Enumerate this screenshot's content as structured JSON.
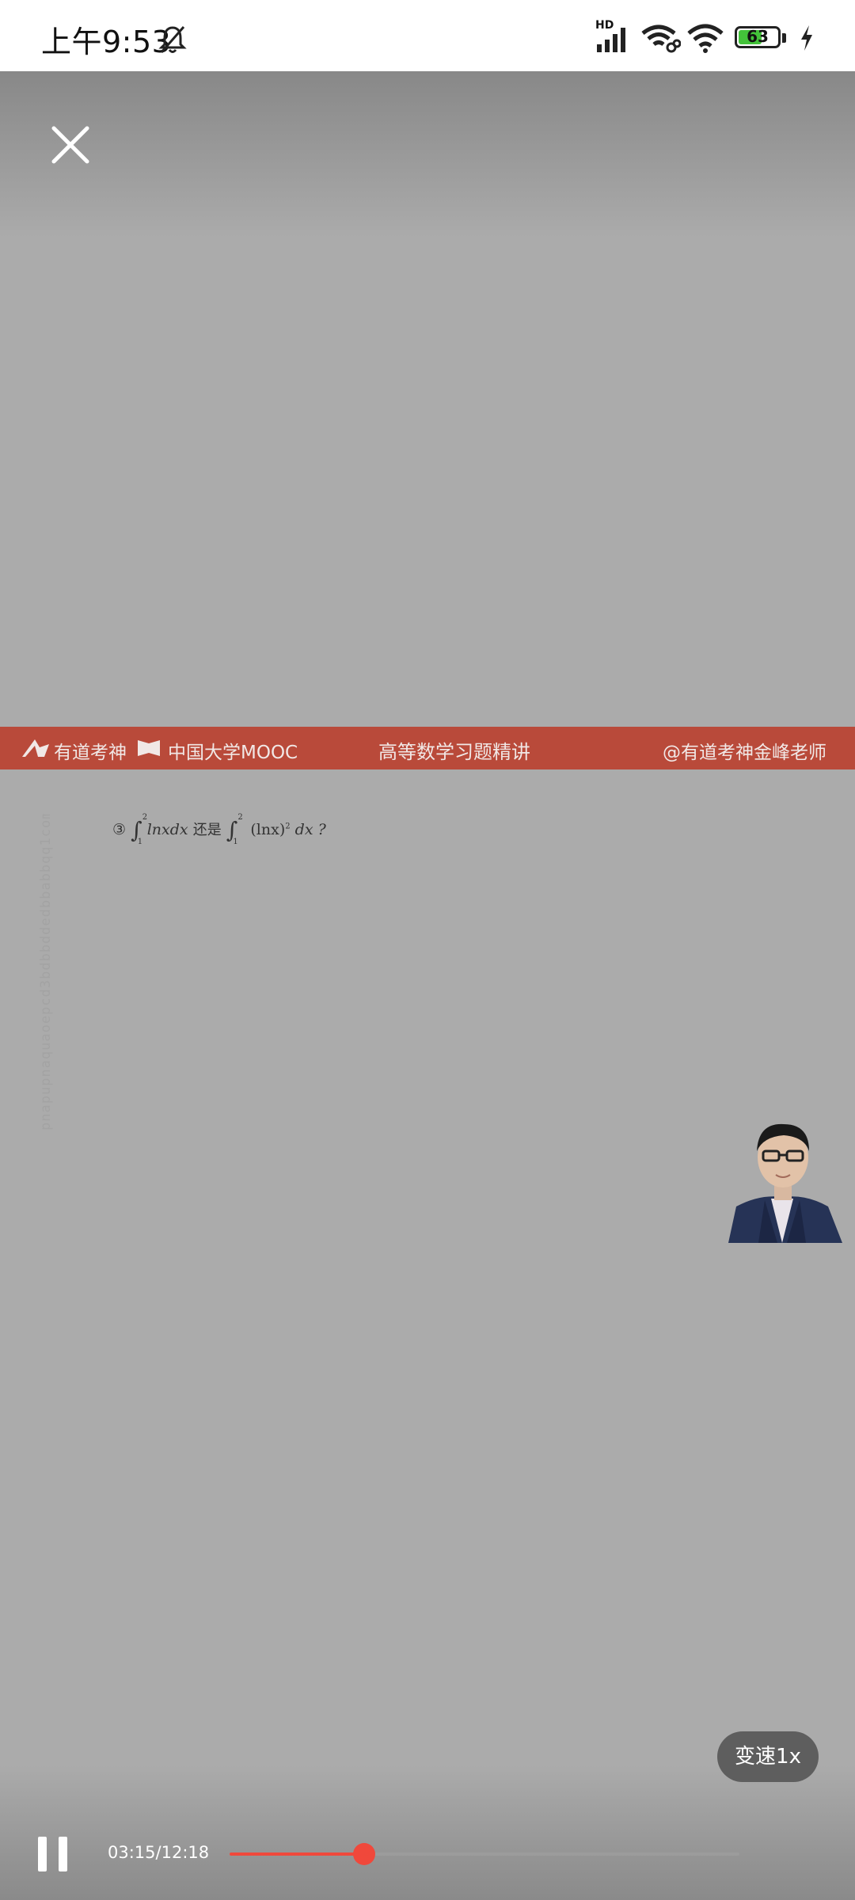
{
  "status_bar": {
    "time": "上午9:53",
    "signal_label": "HD",
    "battery_level": "63",
    "battery_fraction": 0.63,
    "icons": [
      "bell-off-icon",
      "signal-icon",
      "wifi-link-icon",
      "wifi-icon",
      "battery-icon",
      "charging-icon"
    ]
  },
  "player": {
    "close_icon": "close-icon",
    "banner": {
      "brand1": "有道考神",
      "brand2": "中国大学MOOC",
      "course_title": "高等数学习题精讲",
      "teacher_handle": "@有道考神金峰老师"
    },
    "formula": {
      "number": "③",
      "text_a": "lnxdx",
      "connector": "还是",
      "text_b": "(lnx)",
      "text_c": "dx ?",
      "upper": "2",
      "lower": "1",
      "exponent": "2"
    },
    "watermark": "pnapupnaquaoepcd3bdbbddedbbabbqq1com",
    "speed_label": "变速1x",
    "time_display": "03:15/12:18",
    "progress_fraction": 0.264,
    "colors": {
      "banner": "#b94a3a",
      "progress": "#f0483b",
      "background": "#ababab"
    }
  }
}
